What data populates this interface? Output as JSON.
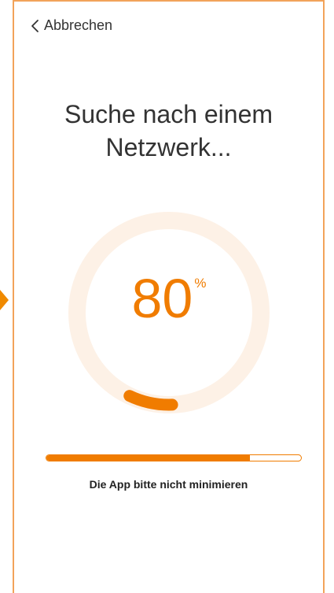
{
  "header": {
    "back_label": "Abbrechen",
    "back_icon": "chevron-left-icon"
  },
  "main": {
    "title_line1": "Suche nach einem",
    "title_line2": "Netzwerk...",
    "progress_value": "80",
    "progress_unit": "%",
    "progress_fraction": 0.8,
    "hint": "Die App bitte nicht minimieren"
  },
  "colors": {
    "accent": "#f07c00",
    "ring_track": "#fdf1e6",
    "frame": "#f2a35a",
    "text": "#333333"
  }
}
